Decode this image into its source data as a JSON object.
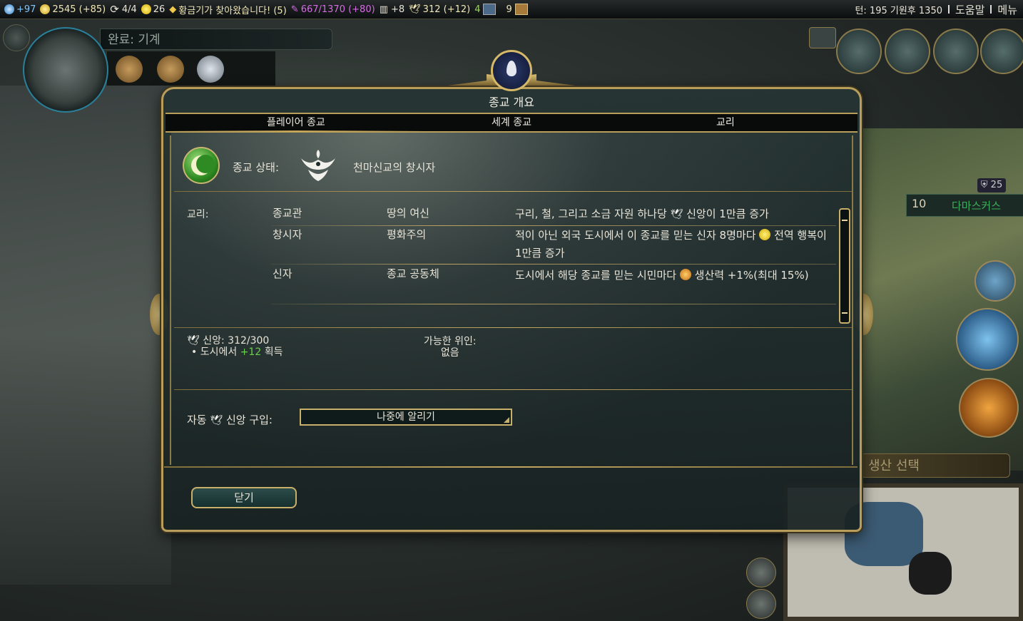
{
  "topbar": {
    "science": "+97",
    "gold": "2545 (+85)",
    "trade_routes": "4/4",
    "happiness": "26",
    "golden_age": "황금기가 찾아왔습니다! (5)",
    "culture": "667/1370 (+80)",
    "tourism": "+8",
    "faith": "312 (+12)",
    "spies": "4",
    "great_works": "9",
    "turn": "턴: 195  기원후 1350",
    "help": "도움말",
    "menu": "메뉴"
  },
  "tech": {
    "label": "완료: 기계"
  },
  "city": {
    "population": "10",
    "name": "다마스커스",
    "defense": "25"
  },
  "production": {
    "label": "생산 선택"
  },
  "dialog": {
    "title": "종교 개요",
    "tabs": [
      "플레이어 종교",
      "세계 종교",
      "교리"
    ],
    "status_label": "종교 상태:",
    "status_value": "천마신교의 창시자",
    "beliefs_label": "교리:",
    "beliefs": [
      {
        "type": "종교관",
        "name": "땅의 여신",
        "desc_before": "구리, 철, 그리고 소금 자원 하나당",
        "desc_after": "신앙이 1만큼 증가"
      },
      {
        "type": "창시자",
        "name": "평화주의",
        "desc_before": "적이 아닌 외국 도시에서 이 종교를 믿는 신자 8명마다",
        "desc_after": "전역 행복이 1만큼 증가"
      },
      {
        "type": "신자",
        "name": "종교 공동체",
        "desc_before": "도시에서 해당 종교를 믿는 시민마다",
        "desc_after": "생산력 +1%(최대 15%)"
      }
    ],
    "faith_label": "신앙: 312/300",
    "faith_city_prefix": "도시에서",
    "faith_city_amount": "+12",
    "faith_city_suffix": "획득",
    "prophet_label": "가능한 위인:",
    "prophet_value": "없음",
    "auto_label_before": "자동",
    "auto_label_after": "신앙 구입:",
    "auto_value": "나중에 알리기",
    "close": "닫기"
  },
  "colors": {
    "frame_gold": "#b89e5a",
    "panel": "#1c2a2a",
    "green_text": "#6ad04a",
    "science": "#7fc6ff",
    "culture": "#d86ae8"
  },
  "icons": [
    "science-icon",
    "gold-icon",
    "trade-route-icon",
    "happiness-icon",
    "golden-age-icon",
    "culture-icon",
    "tourism-icon",
    "faith-icon",
    "spy-icon",
    "great-works-icon",
    "crescent-icon",
    "civ-emblem-icon",
    "scroll-icon"
  ]
}
